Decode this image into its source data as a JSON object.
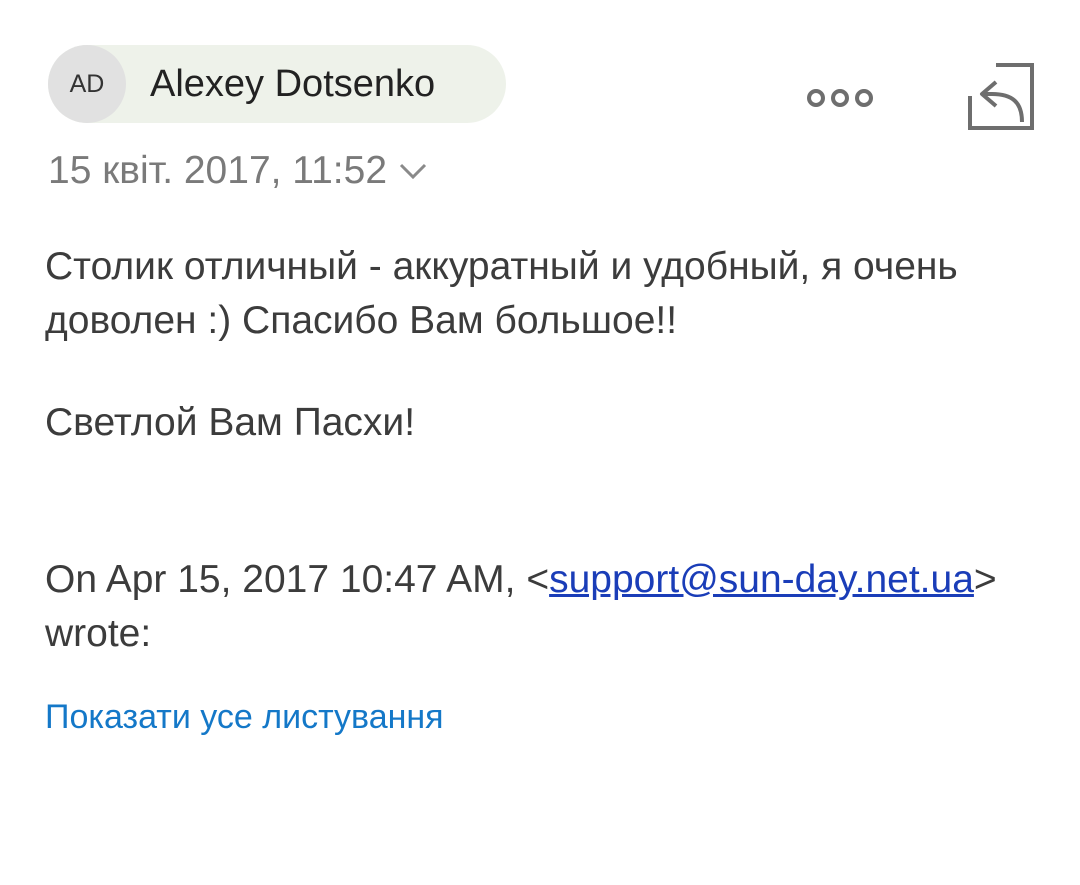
{
  "sender": {
    "initials": "AD",
    "name": "Alexey Dotsenko"
  },
  "date": "15 квіт. 2017, 11:52",
  "message": {
    "line1": "Столик отличный - аккуратный и удобный, я очень доволен :) Спасибо Вам большое!!",
    "line2": "Светлой Вам Пасхи!"
  },
  "quote": {
    "prefix": "On Apr 15, 2017 10:47 AM, <",
    "email": "support@sun-day.net.ua",
    "suffix": "> wrote:"
  },
  "show_thread_label": "Показати усе листування",
  "icons": {
    "more": "more-horizontal-icon",
    "reply": "reply-icon",
    "expand": "chevron-down-icon"
  }
}
